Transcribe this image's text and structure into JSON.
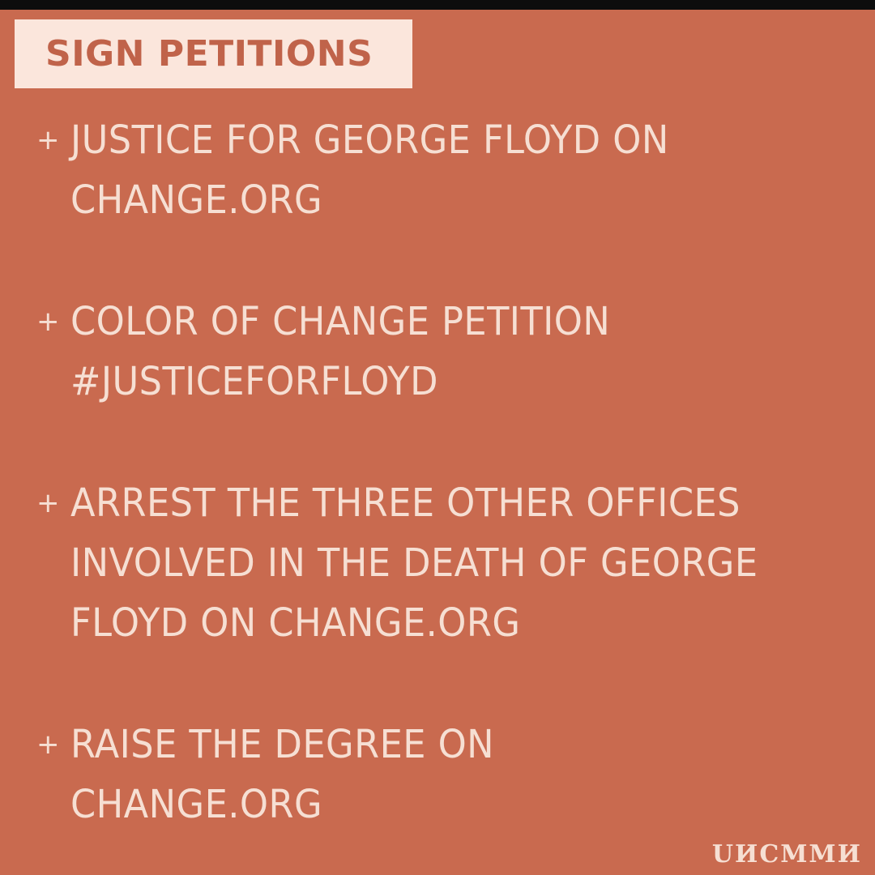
{
  "title": "SIGN PETITIONS",
  "items": [
    {
      "marker": "+",
      "text": "JUSTICE FOR GEORGE FLOYD ON\nCHANGE.ORG"
    },
    {
      "marker": "+",
      "text": "COLOR OF CHANGE PETITION\n#JUSTICEFORFLOYD"
    },
    {
      "marker": "+",
      "text": "ARREST THE THREE OTHER OFFICES\nINVOLVED IN THE DEATH OF GEORGE\nFLOYD ON CHANGE.ORG"
    },
    {
      "marker": "+",
      "text": "RAISE THE DEGREE ON\nCHANGE.ORG"
    }
  ],
  "brand": "UИCMMИ",
  "colors": {
    "background": "#c96a4f",
    "title_box": "#fbe6dc",
    "title_text": "#c0634a",
    "body_text": "#f6dfd3",
    "top_bar": "#0d0d0d"
  }
}
